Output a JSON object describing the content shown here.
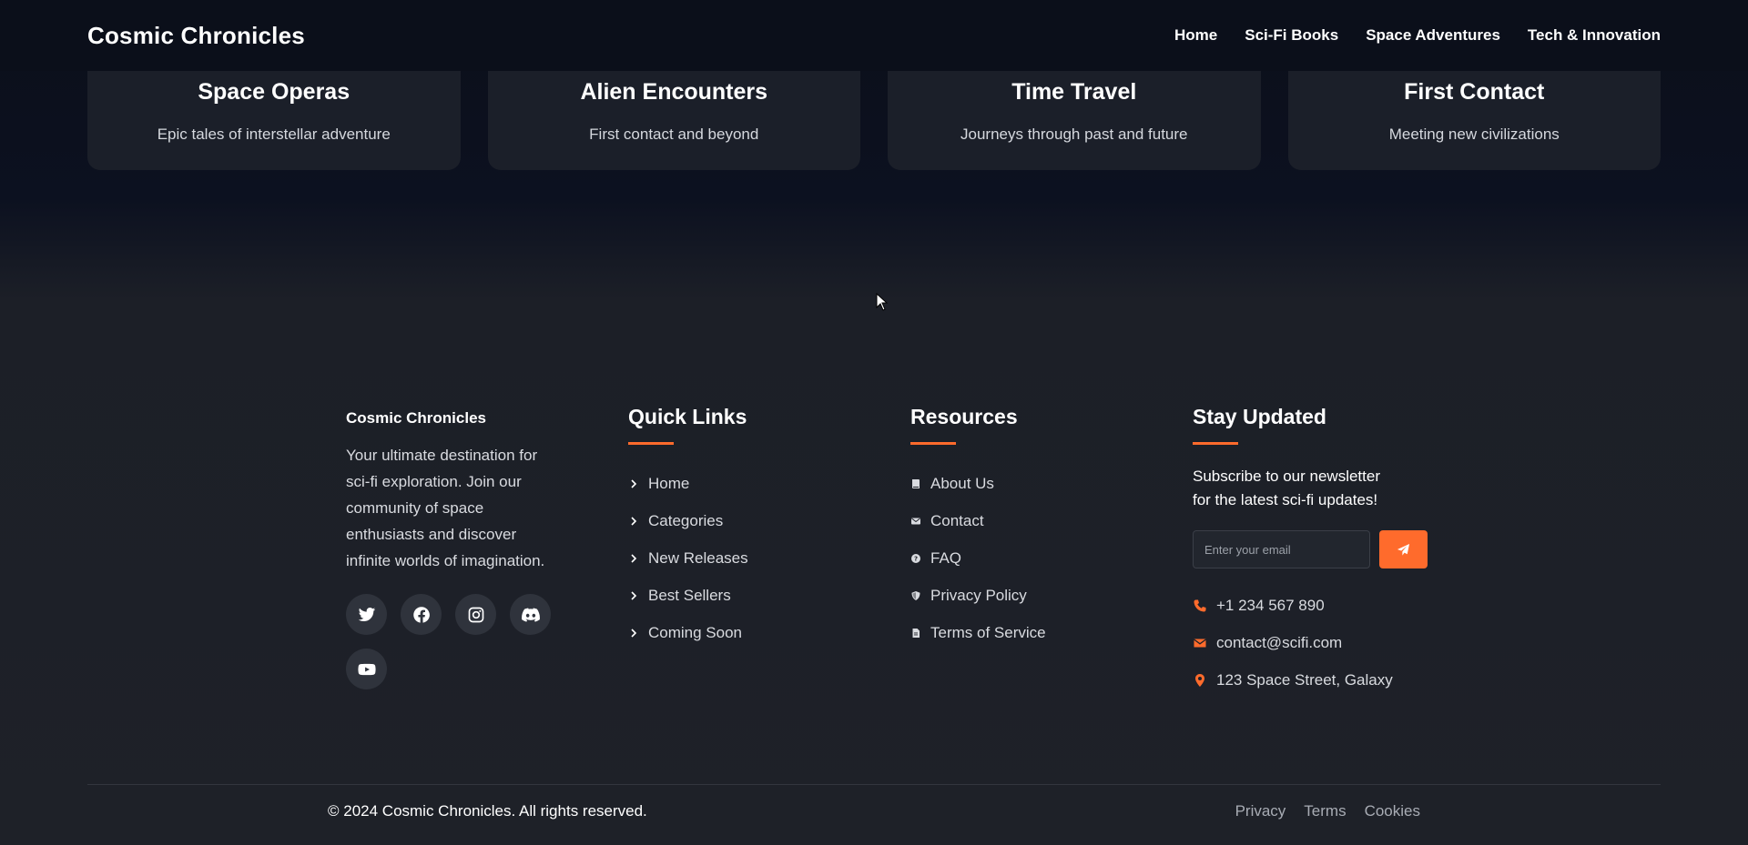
{
  "header": {
    "brand": "Cosmic Chronicles",
    "nav": [
      "Home",
      "Sci-Fi Books",
      "Space Adventures",
      "Tech & Innovation"
    ]
  },
  "categories": [
    {
      "title": "Space Operas",
      "desc": "Epic tales of interstellar adventure"
    },
    {
      "title": "Alien Encounters",
      "desc": "First contact and beyond"
    },
    {
      "title": "Time Travel",
      "desc": "Journeys through past and future"
    },
    {
      "title": "First Contact",
      "desc": "Meeting new civilizations"
    }
  ],
  "footer": {
    "about": {
      "title": "Cosmic Chronicles",
      "text": "Your ultimate destination for sci-fi exploration. Join our community of space enthusiasts and discover infinite worlds of imagination.",
      "socials": [
        "twitter-icon",
        "facebook-icon",
        "instagram-icon",
        "discord-icon",
        "youtube-icon"
      ]
    },
    "quick_links": {
      "heading": "Quick Links",
      "items": [
        "Home",
        "Categories",
        "New Releases",
        "Best Sellers",
        "Coming Soon"
      ]
    },
    "resources": {
      "heading": "Resources",
      "items": [
        {
          "label": "About Us",
          "icon": "book-icon"
        },
        {
          "label": "Contact",
          "icon": "envelope-icon"
        },
        {
          "label": "FAQ",
          "icon": "question-icon"
        },
        {
          "label": "Privacy Policy",
          "icon": "shield-icon"
        },
        {
          "label": "Terms of Service",
          "icon": "document-icon"
        }
      ]
    },
    "newsletter": {
      "heading": "Stay Updated",
      "text": "Subscribe to our newsletter for the latest sci-fi updates!",
      "placeholder": "Enter your email",
      "phone": "+1 234 567 890",
      "email": "contact@scifi.com",
      "address": "123 Space Street, Galaxy"
    },
    "copyright": "© 2024 Cosmic Chronicles. All rights reserved.",
    "legal": [
      "Privacy",
      "Terms",
      "Cookies"
    ]
  },
  "colors": {
    "accent": "#ff6b2c",
    "background": "#1e2128",
    "header": "#0b0f1a"
  }
}
